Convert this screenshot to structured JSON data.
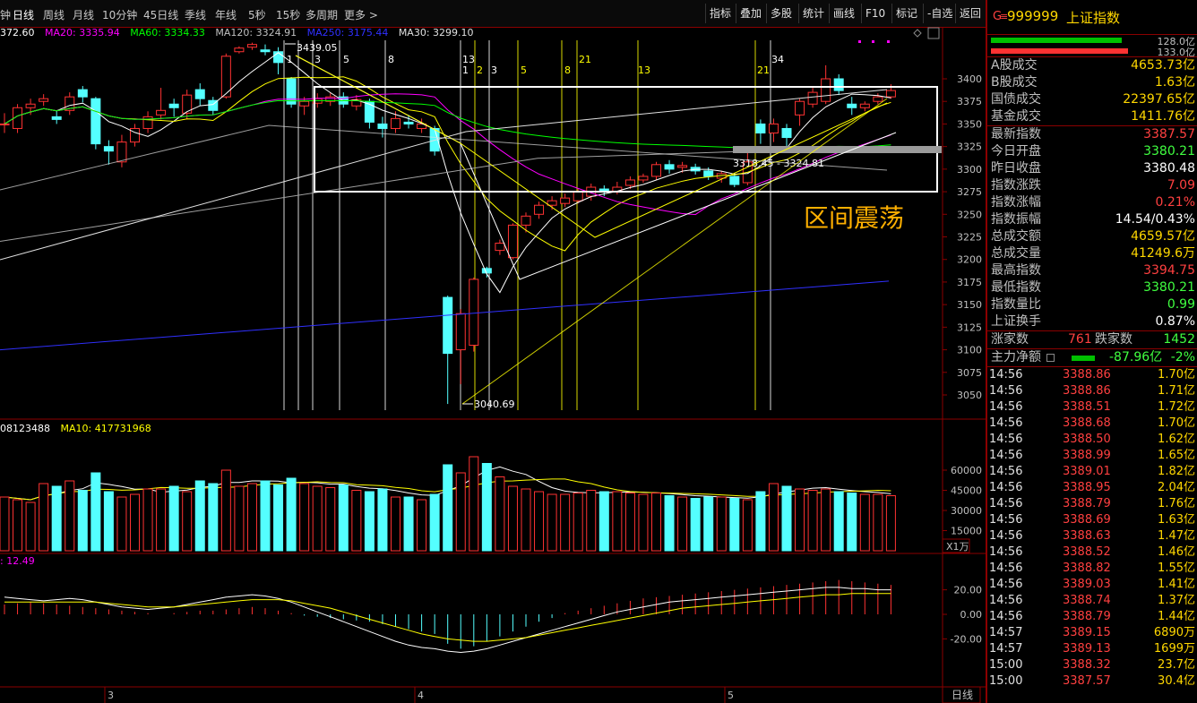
{
  "toolbar": {
    "period_tabs": [
      "钟",
      "日线",
      "周线",
      "月线",
      "10分钟",
      "45日线",
      "季线",
      "年线",
      "5秒",
      "15秒",
      "多周期",
      "更多 >"
    ],
    "active_tab": "日线",
    "buttons": [
      "指标",
      "叠加",
      "多股",
      "统计",
      "画线",
      "F10",
      "标记",
      "-自选",
      "返回"
    ]
  },
  "ma_legend": {
    "ma5": "372.60",
    "ma20": "MA20: 3335.94",
    "ma60": "MA60: 3334.33",
    "ma120": "MA120: 3324.91",
    "ma250": "MA250: 3175.44",
    "ma30": "MA30: 3299.10"
  },
  "vol_legend": {
    "vol": "08123488",
    "ma10": "MA10: 417731968"
  },
  "macd_legend": {
    "value": ": 12.49"
  },
  "annotations": {
    "box_label": "区间震荡",
    "high_mark": "3439.05",
    "low_mark": "3040.69",
    "range_text": "3318.45 - 3324.81",
    "fib_top": [
      "1",
      "3",
      "5",
      "8"
    ],
    "fib_mid": [
      "13",
      "1",
      "2",
      "3",
      "5",
      "8",
      "21",
      "13"
    ],
    "fib_right": [
      "21",
      "34"
    ],
    "x_labels": [
      "3",
      "4",
      "5"
    ],
    "vol_unit": "X1万",
    "period_label": "日线"
  },
  "colors": {
    "up": "#ff3232",
    "down": "#54ffff",
    "ma5": "#ffffff",
    "ma10": "#ffff00",
    "ma20": "#ff00ff",
    "ma60": "#00ff00",
    "ma250": "#3030ff",
    "axis": "#8b0000"
  },
  "chart_data": {
    "type": "candlestick",
    "price_axis": {
      "ticks": [
        3400,
        3375,
        3350,
        3325,
        3300,
        3275,
        3250,
        3225,
        3200,
        3175,
        3150,
        3125,
        3100,
        3075,
        3050
      ],
      "ylim": [
        3040,
        3440
      ]
    },
    "volume_axis": {
      "ticks": [
        60000,
        45000,
        30000,
        15000
      ],
      "unit": "X1万"
    },
    "macd_axis": {
      "ticks": [
        20.0,
        0.0,
        -20.0
      ]
    },
    "candles": [
      {
        "o": 3350,
        "c": 3350,
        "h": 3362,
        "l": 3340
      },
      {
        "o": 3345,
        "c": 3368,
        "h": 3372,
        "l": 3340
      },
      {
        "o": 3368,
        "c": 3372,
        "h": 3378,
        "l": 3360
      },
      {
        "o": 3375,
        "c": 3378,
        "h": 3383,
        "l": 3370
      },
      {
        "o": 3358,
        "c": 3355,
        "h": 3365,
        "l": 3350
      },
      {
        "o": 3365,
        "c": 3380,
        "h": 3385,
        "l": 3360
      },
      {
        "o": 3388,
        "c": 3380,
        "h": 3392,
        "l": 3374
      },
      {
        "o": 3378,
        "c": 3328,
        "h": 3380,
        "l": 3322
      },
      {
        "o": 3325,
        "c": 3320,
        "h": 3332,
        "l": 3305
      },
      {
        "o": 3308,
        "c": 3330,
        "h": 3338,
        "l": 3302
      },
      {
        "o": 3330,
        "c": 3345,
        "h": 3350,
        "l": 3325
      },
      {
        "o": 3345,
        "c": 3358,
        "h": 3364,
        "l": 3340
      },
      {
        "o": 3360,
        "c": 3365,
        "h": 3390,
        "l": 3355
      },
      {
        "o": 3372,
        "c": 3368,
        "h": 3378,
        "l": 3358
      },
      {
        "o": 3362,
        "c": 3382,
        "h": 3388,
        "l": 3355
      },
      {
        "o": 3388,
        "c": 3378,
        "h": 3395,
        "l": 3370
      },
      {
        "o": 3376,
        "c": 3365,
        "h": 3380,
        "l": 3360
      },
      {
        "o": 3380,
        "c": 3425,
        "h": 3428,
        "l": 3378
      },
      {
        "o": 3430,
        "c": 3434,
        "h": 3436,
        "l": 3428
      },
      {
        "o": 3435,
        "c": 3438,
        "h": 3440,
        "l": 3432
      },
      {
        "o": 3432,
        "c": 3430,
        "h": 3438,
        "l": 3426
      },
      {
        "o": 3430,
        "c": 3418,
        "h": 3435,
        "l": 3405
      },
      {
        "o": 3400,
        "c": 3372,
        "h": 3402,
        "l": 3368
      },
      {
        "o": 3370,
        "c": 3375,
        "h": 3380,
        "l": 3360
      },
      {
        "o": 3373,
        "c": 3378,
        "h": 3384,
        "l": 3368
      },
      {
        "o": 3375,
        "c": 3380,
        "h": 3385,
        "l": 3370
      },
      {
        "o": 3380,
        "c": 3372,
        "h": 3385,
        "l": 3368
      },
      {
        "o": 3370,
        "c": 3377,
        "h": 3382,
        "l": 3365
      },
      {
        "o": 3375,
        "c": 3352,
        "h": 3378,
        "l": 3345
      },
      {
        "o": 3350,
        "c": 3345,
        "h": 3358,
        "l": 3335
      },
      {
        "o": 3345,
        "c": 3356,
        "h": 3364,
        "l": 3340
      },
      {
        "o": 3352,
        "c": 3350,
        "h": 3360,
        "l": 3345
      },
      {
        "o": 3345,
        "c": 3350,
        "h": 3356,
        "l": 3340
      },
      {
        "o": 3345,
        "c": 3320,
        "h": 3348,
        "l": 3315
      },
      {
        "o": 3158,
        "c": 3096,
        "h": 3160,
        "l": 3040
      },
      {
        "o": 3100,
        "c": 3140,
        "h": 3145,
        "l": 3062
      },
      {
        "o": 3105,
        "c": 3178,
        "h": 3180,
        "l": 3098
      },
      {
        "o": 3190,
        "c": 3185,
        "h": 3192,
        "l": 3180
      },
      {
        "o": 3210,
        "c": 3218,
        "h": 3222,
        "l": 3205
      },
      {
        "o": 3202,
        "c": 3238,
        "h": 3240,
        "l": 3200
      },
      {
        "o": 3238,
        "c": 3248,
        "h": 3252,
        "l": 3230
      },
      {
        "o": 3250,
        "c": 3260,
        "h": 3264,
        "l": 3245
      },
      {
        "o": 3260,
        "c": 3265,
        "h": 3270,
        "l": 3255
      },
      {
        "o": 3262,
        "c": 3268,
        "h": 3273,
        "l": 3258
      },
      {
        "o": 3265,
        "c": 3275,
        "h": 3278,
        "l": 3262
      },
      {
        "o": 3270,
        "c": 3280,
        "h": 3284,
        "l": 3265
      },
      {
        "o": 3278,
        "c": 3275,
        "h": 3282,
        "l": 3270
      },
      {
        "o": 3275,
        "c": 3280,
        "h": 3286,
        "l": 3272
      },
      {
        "o": 3282,
        "c": 3288,
        "h": 3292,
        "l": 3278
      },
      {
        "o": 3288,
        "c": 3292,
        "h": 3295,
        "l": 3285
      },
      {
        "o": 3292,
        "c": 3305,
        "h": 3308,
        "l": 3288
      },
      {
        "o": 3305,
        "c": 3300,
        "h": 3310,
        "l": 3295
      },
      {
        "o": 3302,
        "c": 3304,
        "h": 3308,
        "l": 3296
      },
      {
        "o": 3302,
        "c": 3298,
        "h": 3306,
        "l": 3294
      },
      {
        "o": 3298,
        "c": 3292,
        "h": 3302,
        "l": 3288
      },
      {
        "o": 3290,
        "c": 3295,
        "h": 3298,
        "l": 3285
      },
      {
        "o": 3292,
        "c": 3283,
        "h": 3296,
        "l": 3280
      },
      {
        "o": 3285,
        "c": 3308,
        "h": 3320,
        "l": 3282
      },
      {
        "o": 3350,
        "c": 3340,
        "h": 3355,
        "l": 3328
      },
      {
        "o": 3340,
        "c": 3350,
        "h": 3356,
        "l": 3330
      },
      {
        "o": 3345,
        "c": 3335,
        "h": 3350,
        "l": 3325
      },
      {
        "o": 3360,
        "c": 3375,
        "h": 3378,
        "l": 3348
      },
      {
        "o": 3372,
        "c": 3385,
        "h": 3390,
        "l": 3368
      },
      {
        "o": 3375,
        "c": 3400,
        "h": 3415,
        "l": 3372
      },
      {
        "o": 3400,
        "c": 3387,
        "h": 3405,
        "l": 3382
      },
      {
        "o": 3372,
        "c": 3368,
        "h": 3380,
        "l": 3360
      },
      {
        "o": 3368,
        "c": 3372,
        "h": 3375,
        "l": 3364
      },
      {
        "o": 3375,
        "c": 3380,
        "h": 3384,
        "l": 3372
      },
      {
        "o": 3380,
        "c": 3387,
        "h": 3394,
        "l": 3378
      }
    ],
    "volume": [
      40,
      38,
      36,
      50,
      48,
      52,
      45,
      58,
      44,
      40,
      42,
      46,
      46,
      48,
      44,
      52,
      50,
      60,
      48,
      50,
      52,
      49,
      54,
      50,
      48,
      47,
      49,
      45,
      44,
      46,
      40,
      40,
      38,
      42,
      64,
      58,
      70,
      65,
      55,
      48,
      46,
      44,
      42,
      42,
      43,
      45,
      44,
      44,
      43,
      42,
      43,
      41,
      40,
      39,
      40,
      40,
      39,
      38,
      44,
      50,
      48,
      46,
      45,
      46,
      44,
      43,
      42,
      42,
      41
    ],
    "macd_hist": [
      8,
      9,
      10,
      9,
      8,
      7,
      6,
      5,
      4,
      3,
      2,
      1,
      0,
      1,
      2,
      3,
      3,
      4,
      5,
      6,
      5,
      3,
      1,
      -1,
      -2,
      -3,
      -4,
      -5,
      -6,
      -8,
      -10,
      -12,
      -14,
      -16,
      -24,
      -28,
      -26,
      -22,
      -18,
      -14,
      -10,
      -6,
      -3,
      1,
      3,
      5,
      7,
      9,
      11,
      13,
      14,
      15,
      16,
      17,
      18,
      19,
      20,
      21,
      22,
      23,
      24,
      25,
      26,
      27,
      28,
      27,
      26,
      25,
      24
    ],
    "macd_dif": [
      14,
      13,
      12,
      11,
      12,
      13,
      12,
      10,
      8,
      6,
      5,
      4,
      5,
      6,
      8,
      10,
      12,
      14,
      15,
      16,
      15,
      13,
      10,
      6,
      2,
      -2,
      -6,
      -10,
      -14,
      -18,
      -22,
      -25,
      -27,
      -28,
      -30,
      -31,
      -30,
      -28,
      -25,
      -22,
      -19,
      -16,
      -13,
      -10,
      -7,
      -4,
      -1,
      2,
      4,
      6,
      8,
      10,
      11,
      12,
      13,
      14,
      15,
      16,
      17,
      18,
      19,
      20,
      21,
      22,
      22,
      21,
      21,
      20,
      20
    ],
    "macd_dea": [
      10,
      10,
      10,
      10,
      10,
      10,
      10,
      10,
      9,
      8,
      7,
      6,
      6,
      6,
      7,
      8,
      9,
      10,
      11,
      12,
      12,
      12,
      11,
      9,
      7,
      5,
      2,
      -1,
      -4,
      -7,
      -10,
      -13,
      -16,
      -18,
      -20,
      -21,
      -22,
      -22,
      -21,
      -20,
      -19,
      -17,
      -15,
      -13,
      -11,
      -9,
      -7,
      -5,
      -3,
      -1,
      1,
      3,
      5,
      6,
      7,
      8,
      9,
      10,
      11,
      12,
      13,
      14,
      15,
      16,
      16,
      17,
      17,
      17,
      17
    ]
  },
  "quote_panel": {
    "g_label": "G",
    "code": "999999",
    "name": "上证指数",
    "strength": [
      {
        "value": "128.0亿",
        "color": "#00c000",
        "fraction": 0.62
      },
      {
        "value": "133.0亿",
        "color": "#ff3232",
        "fraction": 0.65
      }
    ],
    "stats": [
      {
        "label": "A股成交",
        "value": "4653.73亿",
        "color": "#ffd700"
      },
      {
        "label": "B股成交",
        "value": "1.63亿",
        "color": "#ffd700"
      },
      {
        "label": "国债成交",
        "value": "22397.65亿",
        "color": "#ffd700"
      },
      {
        "label": "基金成交",
        "value": "1411.76亿",
        "color": "#ffd700"
      }
    ],
    "quote": [
      {
        "label": "最新指数",
        "value": "3387.57",
        "color": "#ff4040"
      },
      {
        "label": "今日开盘",
        "value": "3380.21",
        "color": "#40ff40"
      },
      {
        "label": "昨日收盘",
        "value": "3380.48",
        "color": "#ffffff"
      },
      {
        "label": "指数涨跌",
        "value": "7.09",
        "color": "#ff4040"
      },
      {
        "label": "指数涨幅",
        "value": "0.21%",
        "color": "#ff4040"
      },
      {
        "label": "指数振幅",
        "value": "14.54/0.43%",
        "color": "#ffffff"
      },
      {
        "label": "总成交额",
        "value": "4659.57亿",
        "color": "#ffd700"
      },
      {
        "label": "总成交量",
        "value": "41249.6万",
        "color": "#ffd700"
      },
      {
        "label": "最高指数",
        "value": "3394.75",
        "color": "#ff4040"
      },
      {
        "label": "最低指数",
        "value": "3380.21",
        "color": "#40ff40"
      },
      {
        "label": "指数量比",
        "value": "0.99",
        "color": "#40ff40"
      },
      {
        "label": "上证换手",
        "value": "0.87%",
        "color": "#ffffff"
      }
    ],
    "breadth": {
      "up_label": "涨家数",
      "up": "761",
      "down_label": "跌家数",
      "down": "1452"
    },
    "main_flow": {
      "label": "主力净额",
      "value": "-87.96亿",
      "pct": "-2%"
    },
    "ticks": [
      {
        "time": "14:56",
        "price": "3388.86",
        "amount": "1.70亿"
      },
      {
        "time": "14:56",
        "price": "3388.86",
        "amount": "1.71亿"
      },
      {
        "time": "14:56",
        "price": "3388.51",
        "amount": "1.72亿"
      },
      {
        "time": "14:56",
        "price": "3388.68",
        "amount": "1.70亿"
      },
      {
        "time": "14:56",
        "price": "3388.50",
        "amount": "1.62亿"
      },
      {
        "time": "14:56",
        "price": "3388.99",
        "amount": "1.65亿"
      },
      {
        "time": "14:56",
        "price": "3389.01",
        "amount": "1.82亿"
      },
      {
        "time": "14:56",
        "price": "3388.95",
        "amount": "2.04亿"
      },
      {
        "time": "14:56",
        "price": "3388.79",
        "amount": "1.76亿"
      },
      {
        "time": "14:56",
        "price": "3388.69",
        "amount": "1.63亿"
      },
      {
        "time": "14:56",
        "price": "3388.63",
        "amount": "1.47亿"
      },
      {
        "time": "14:56",
        "price": "3388.52",
        "amount": "1.46亿"
      },
      {
        "time": "14:56",
        "price": "3388.82",
        "amount": "1.55亿"
      },
      {
        "time": "14:56",
        "price": "3389.03",
        "amount": "1.41亿"
      },
      {
        "time": "14:56",
        "price": "3388.74",
        "amount": "1.37亿"
      },
      {
        "time": "14:56",
        "price": "3388.79",
        "amount": "1.44亿"
      },
      {
        "time": "14:57",
        "price": "3389.15",
        "amount": "6890万"
      },
      {
        "time": "14:57",
        "price": "3389.13",
        "amount": "1699万"
      },
      {
        "time": "15:00",
        "price": "3388.32",
        "amount": "23.7亿"
      },
      {
        "time": "15:00",
        "price": "3387.57",
        "amount": "30.4亿"
      }
    ]
  }
}
